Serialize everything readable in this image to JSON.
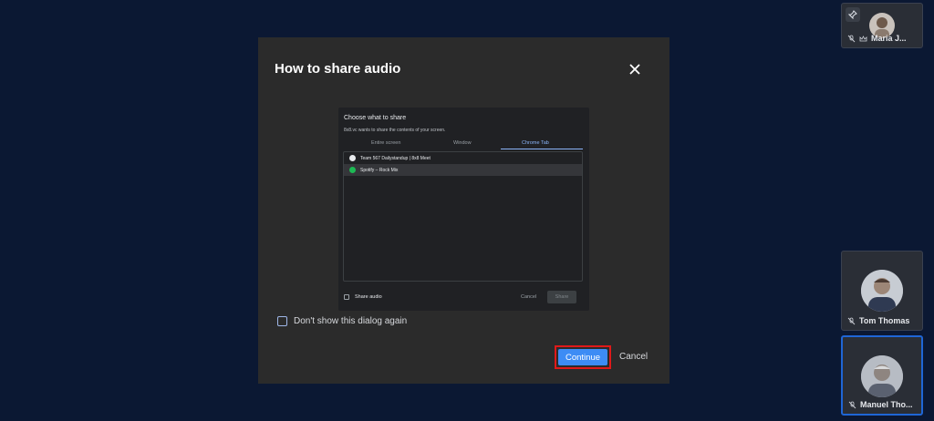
{
  "participants": [
    {
      "name": "Maria J...",
      "muted": true,
      "moderator": true,
      "pinnable": true
    },
    {
      "name": "Tom Thomas",
      "muted": true
    },
    {
      "name": "Manuel Tho...",
      "muted": true,
      "active_speaker": true
    }
  ],
  "dialog": {
    "title": "How to share audio",
    "preview": {
      "title": "Choose what to share",
      "subtitle": "8x8.vc wants to share the contents of your screen.",
      "tabs": [
        "Entire screen",
        "Window",
        "Chrome Tab"
      ],
      "active_tab": "Chrome Tab",
      "items": [
        {
          "label": "Team 567 Dailystandup | 8x8 Meet",
          "icon_color": "#e8eaed"
        },
        {
          "label": "Spotify – Rock Mix",
          "icon_color": "#1db954"
        }
      ],
      "share_audio_label": "Share audio",
      "cancel_label": "Cancel",
      "share_label": "Share"
    },
    "dont_show_label": "Don't show this dialog again",
    "continue_label": "Continue",
    "cancel_label": "Cancel"
  },
  "colors": {
    "background": "#0b1833",
    "modal": "#2b2b2b",
    "accent": "#3d8cf5",
    "highlight": "#e01919",
    "active_border": "#1f66d6"
  }
}
